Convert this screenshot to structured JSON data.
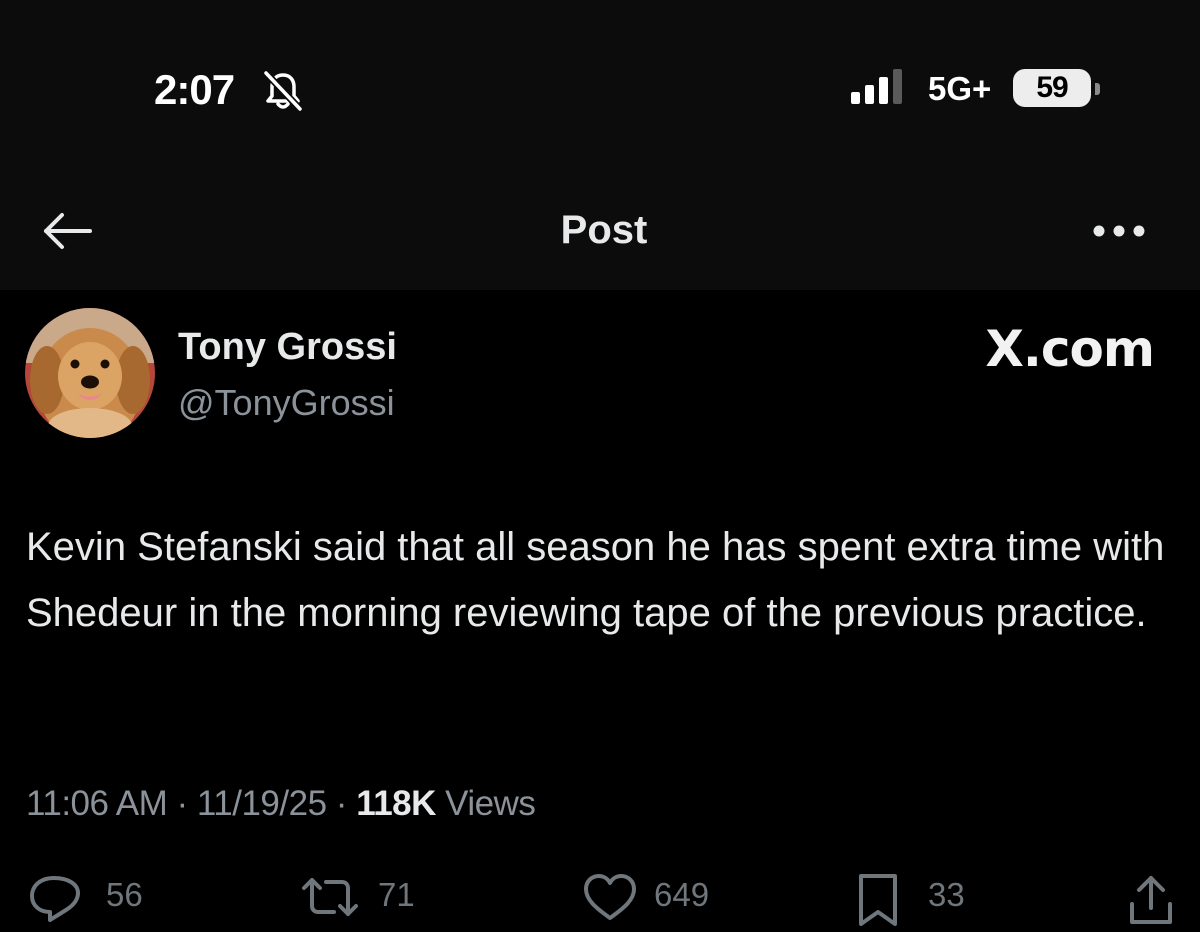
{
  "status_bar": {
    "time": "2:07",
    "network": "5G+",
    "battery_level": "59"
  },
  "nav": {
    "title": "Post"
  },
  "post": {
    "author_name": "Tony Grossi",
    "author_handle": "@TonyGrossi",
    "watermark": "X.com",
    "text": "Kevin Stefanski said that all season he has spent extra time with Shedeur in the morning reviewing tape of the previous practice.",
    "time": "11:06 AM",
    "date": "11/19/25",
    "separator": "·",
    "views_count": "118K",
    "views_label": "Views"
  },
  "actions": {
    "replies": "56",
    "reposts": "71",
    "likes": "649",
    "bookmarks": "33"
  },
  "colors": {
    "background": "#000000",
    "header_background": "#0c0c0c",
    "text_primary": "#e7e9ea",
    "text_secondary": "#8b9299"
  },
  "icons": [
    "bell-slash-icon",
    "signal-icon",
    "battery-icon",
    "back-arrow-icon",
    "more-icon",
    "reply-icon",
    "repost-icon",
    "like-icon",
    "bookmark-icon",
    "share-icon"
  ]
}
